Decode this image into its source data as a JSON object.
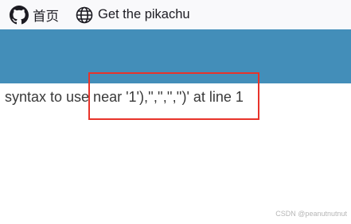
{
  "nav": {
    "home": {
      "icon": "github-icon",
      "label": "首页"
    },
    "pikachu": {
      "icon": "globe-icon",
      "label": "Get the pikachu"
    }
  },
  "content": {
    "error_text": "syntax to use near '1'),'','','','')' at line 1"
  },
  "annotation": {
    "color": "#e8332a"
  },
  "header": {
    "color": "#438eb9"
  },
  "watermark": "CSDN @peanutnutnut"
}
